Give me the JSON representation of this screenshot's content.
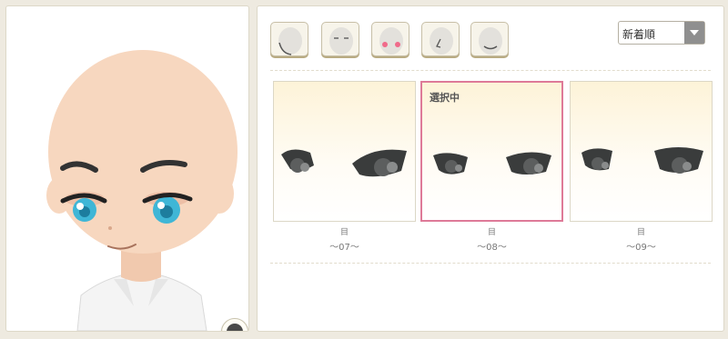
{
  "preview": {
    "zoom_icon": "minus-circle-icon",
    "skin_color": "#f7d7bf",
    "eye_color": "#3fb6d6"
  },
  "categories": [
    {
      "name": "face-shape",
      "icon": "face-outline-icon"
    },
    {
      "name": "eyebrows",
      "icon": "face-eyebrows-icon"
    },
    {
      "name": "cheeks",
      "icon": "face-blush-icon",
      "accent": "#f06a8a"
    },
    {
      "name": "nose",
      "icon": "face-nose-icon"
    },
    {
      "name": "mouth",
      "icon": "face-mouth-icon"
    }
  ],
  "sort": {
    "selected": "新着順"
  },
  "items": [
    {
      "id_text": "目",
      "name": "～07～"
    },
    {
      "id_text": "目",
      "name": "～08～",
      "selected_label": "選択中"
    },
    {
      "id_text": "目",
      "name": "～09～"
    }
  ],
  "colors": {
    "selected_border": "#de7a98",
    "card_gradient_top": "#fdf3d8"
  }
}
